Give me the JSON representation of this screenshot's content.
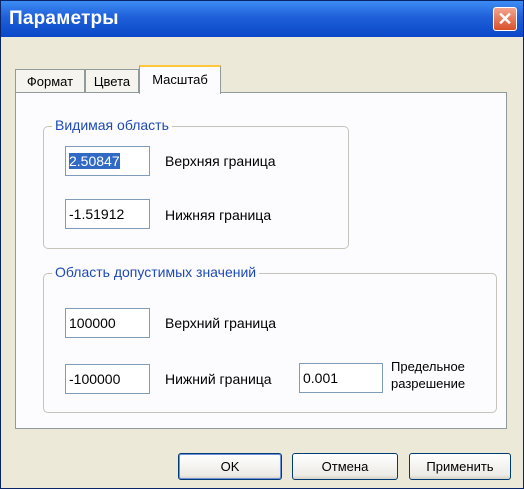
{
  "window": {
    "title": "Параметры",
    "close_glyph": "✕"
  },
  "tabs": [
    {
      "label": "Формат",
      "active": false
    },
    {
      "label": "Цвета",
      "active": false
    },
    {
      "label": "Масштаб",
      "active": true
    }
  ],
  "visible_area": {
    "title": "Видимая область",
    "upper_value": "2.50847",
    "upper_label": "Верхняя граница",
    "lower_value": "-1.51912",
    "lower_label": "Нижняя граница"
  },
  "allowed_area": {
    "title": "Область допустимых значений",
    "upper_value": "100000",
    "upper_label": "Верхний граница",
    "lower_value": "-100000",
    "lower_label": "Нижний граница",
    "resolution_value": "0.001",
    "resolution_label_1": "Предельное",
    "resolution_label_2": "разрешение"
  },
  "buttons": {
    "ok": "OK",
    "cancel": "Отмена",
    "apply": "Применить"
  }
}
